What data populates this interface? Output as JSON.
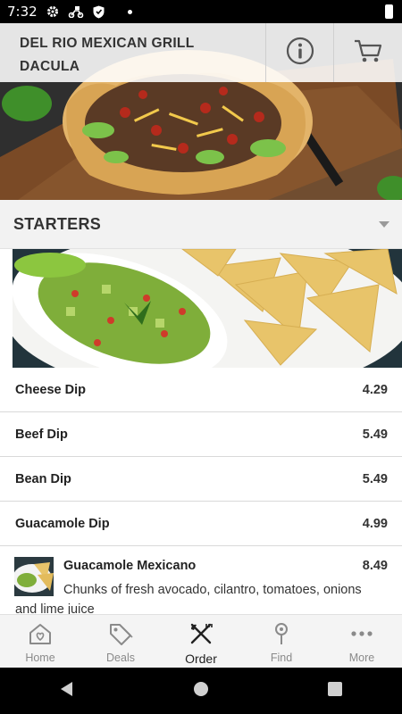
{
  "status_bar": {
    "time": "7:32"
  },
  "header": {
    "restaurant_line1": "DEL RIO MEXICAN GRILL",
    "restaurant_line2": "DACULA",
    "info_icon": "info-icon",
    "cart_icon": "cart-icon"
  },
  "section": {
    "title": "STARTERS",
    "expanded_icon": "chevron-down-icon"
  },
  "menu_items": [
    {
      "name": "Cheese Dip",
      "price": "4.29"
    },
    {
      "name": "Beef Dip",
      "price": "5.49"
    },
    {
      "name": "Bean Dip",
      "price": "5.49"
    },
    {
      "name": "Guacamole Dip",
      "price": "4.99"
    }
  ],
  "featured_item": {
    "name": "Guacamole Mexicano",
    "price": "8.49",
    "description": "Chunks of fresh avocado, cilantro, tomatoes, onions and lime juice"
  },
  "tabs": [
    {
      "label": "Home",
      "icon": "home-icon"
    },
    {
      "label": "Deals",
      "icon": "tag-icon"
    },
    {
      "label": "Order",
      "icon": "utensils-icon",
      "active": true
    },
    {
      "label": "Find",
      "icon": "location-pin-icon"
    },
    {
      "label": "More",
      "icon": "more-dots-icon"
    }
  ],
  "colors": {
    "accent": "#222222",
    "inactive": "#8a8a8a",
    "section_bg": "#f2f2f2"
  }
}
